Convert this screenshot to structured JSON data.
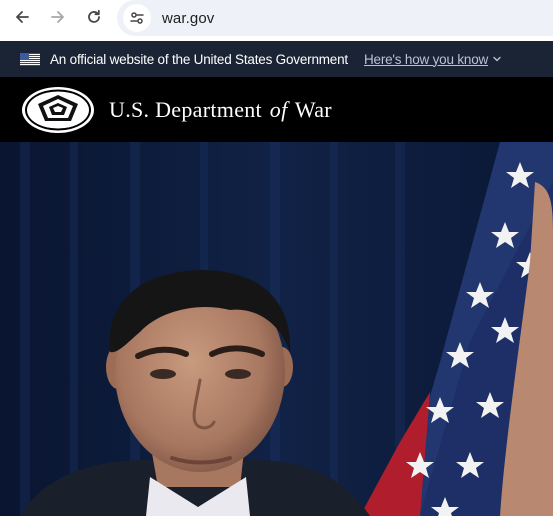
{
  "browser": {
    "url": "war.gov",
    "back_label": "Back",
    "forward_label": "Forward",
    "reload_label": "Reload"
  },
  "gov_banner": {
    "flag_icon": "us-flag-icon",
    "text": "An official website of the United States Government",
    "link_text": "Here's how you know",
    "link_color": "#b9c3d6",
    "background": "#1b2434"
  },
  "header": {
    "logo_icon": "pentagon-seal-icon",
    "title_part1": "U.S. Department",
    "title_of": "of",
    "title_part2": "War",
    "background": "#000000"
  },
  "hero": {
    "description_icon": "press-photo",
    "background": "#0c1a38"
  }
}
